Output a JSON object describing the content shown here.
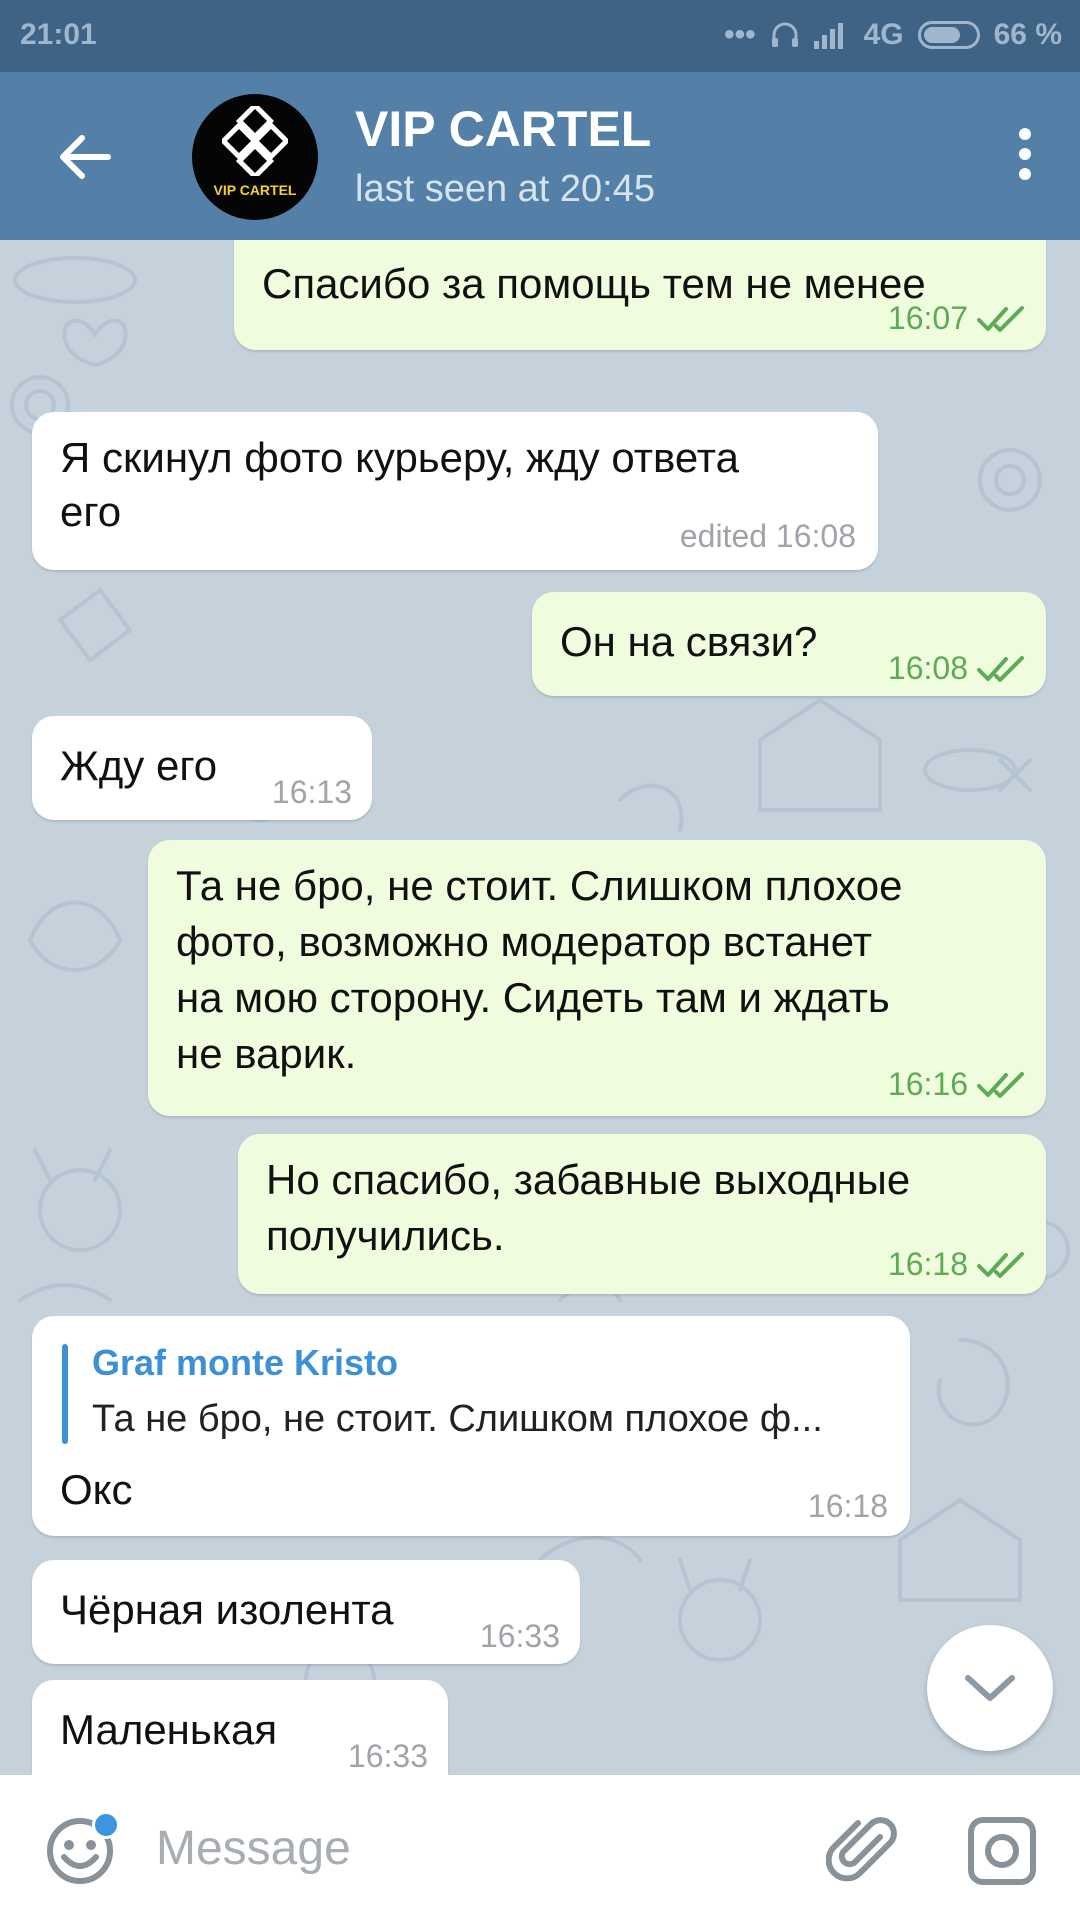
{
  "status_bar": {
    "time": "21:01",
    "signal": "4G",
    "battery": "66 %"
  },
  "header": {
    "title": "VIP CARTEL",
    "status": "last seen at 20:45",
    "avatar_text": "VIP CARTEL"
  },
  "messages": [
    {
      "text": "Спасибо за помощь тем не менее",
      "time": "16:07"
    },
    {
      "text_line1": "Я скинул фото курьеру, жду ответа",
      "text_line2": "его",
      "time": "edited 16:08"
    },
    {
      "text": "Он на связи?",
      "time": "16:08"
    },
    {
      "text": "Жду его",
      "time": "16:13"
    },
    {
      "line1": "Та не бро, не стоит. Слишком плохое",
      "line2": "фото, возможно модератор встанет",
      "line3": "на мою сторону. Сидеть там и ждать",
      "line4": "не варик.",
      "time": "16:16"
    },
    {
      "line1": "Но спасибо, забавные выходные",
      "line2": "получились.",
      "time": "16:18"
    },
    {
      "reply_name": "Graf monte Kristo",
      "reply_text": "Та не бро, не стоит. Слишком плохое ф...",
      "text": "Окс",
      "time": "16:18"
    },
    {
      "text": "Чёрная изолента",
      "time": "16:33"
    },
    {
      "text": "Маленькая",
      "time": "16:33"
    }
  ],
  "input": {
    "placeholder": "Message"
  },
  "icons": {
    "back": "arrow-left-icon",
    "menu": "more-vertical-icon",
    "read": "double-check-icon",
    "scroll": "chevron-down-icon",
    "emoji": "smile-icon",
    "attach": "paperclip-icon",
    "camera": "camera-icon"
  },
  "colors": {
    "header": "#5480a8",
    "status_bar": "#3f6384",
    "outgoing_bubble": "#effdde",
    "incoming_bubble": "#ffffff",
    "check": "#5faa57",
    "accent": "#3d90d3",
    "wallpaper": "#c5d2dc"
  }
}
